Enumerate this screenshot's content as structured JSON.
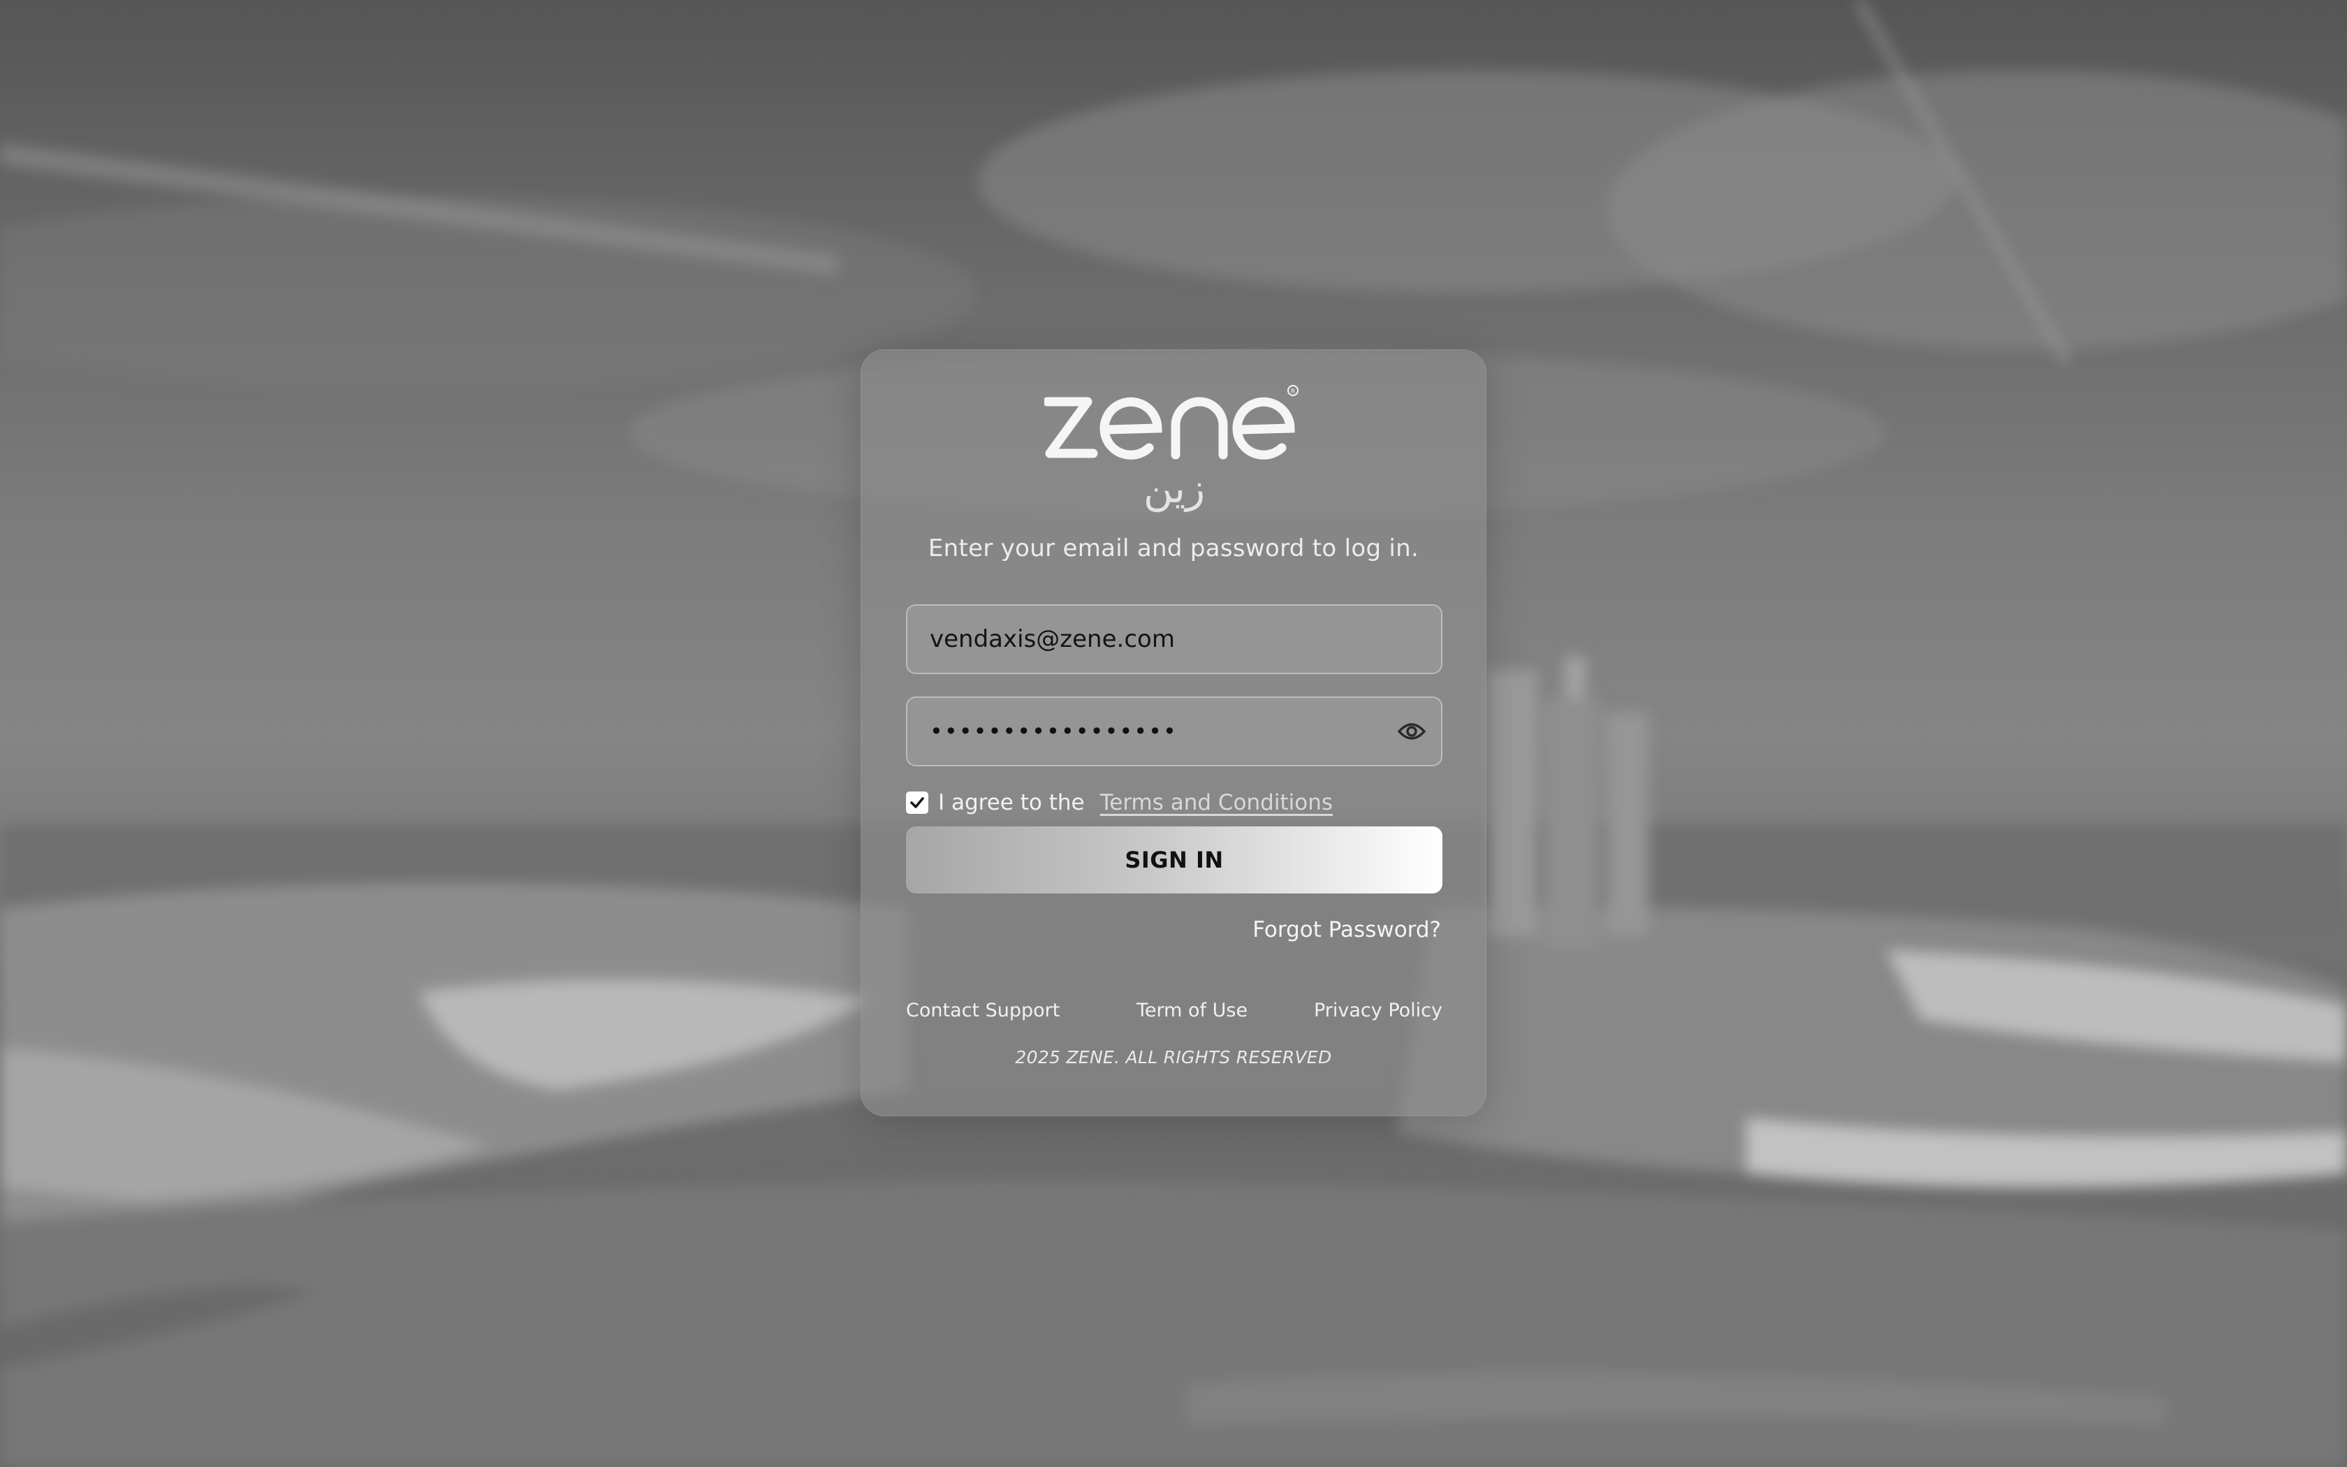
{
  "brand": {
    "logo_latin": "zene",
    "logo_arabic": "زين",
    "logo_mark": "®"
  },
  "login": {
    "subtitle": "Enter your email and password to log in.",
    "email_value": "vendaxis@zene.com",
    "password_value": "•••••••••••••••••",
    "agree_text": "I agree to the",
    "terms_link": "Terms and Conditions",
    "agree_checked": true,
    "signin_label": "SIGN IN",
    "forgot_label": "Forgot Password?"
  },
  "footer": {
    "links": [
      "Contact Support",
      "Term of Use",
      "Privacy Policy"
    ],
    "copyright": "2025 ZENE. ALL RIGHTS RESERVED"
  },
  "icons": {
    "password_toggle": "eye-icon",
    "checkbox": "checkmark-icon"
  },
  "colors": {
    "card_bg": "#8c8c8c",
    "button_gradient_start": "#a6a6a6",
    "button_gradient_end": "#ffffff",
    "text_light": "#f2f2f2"
  }
}
